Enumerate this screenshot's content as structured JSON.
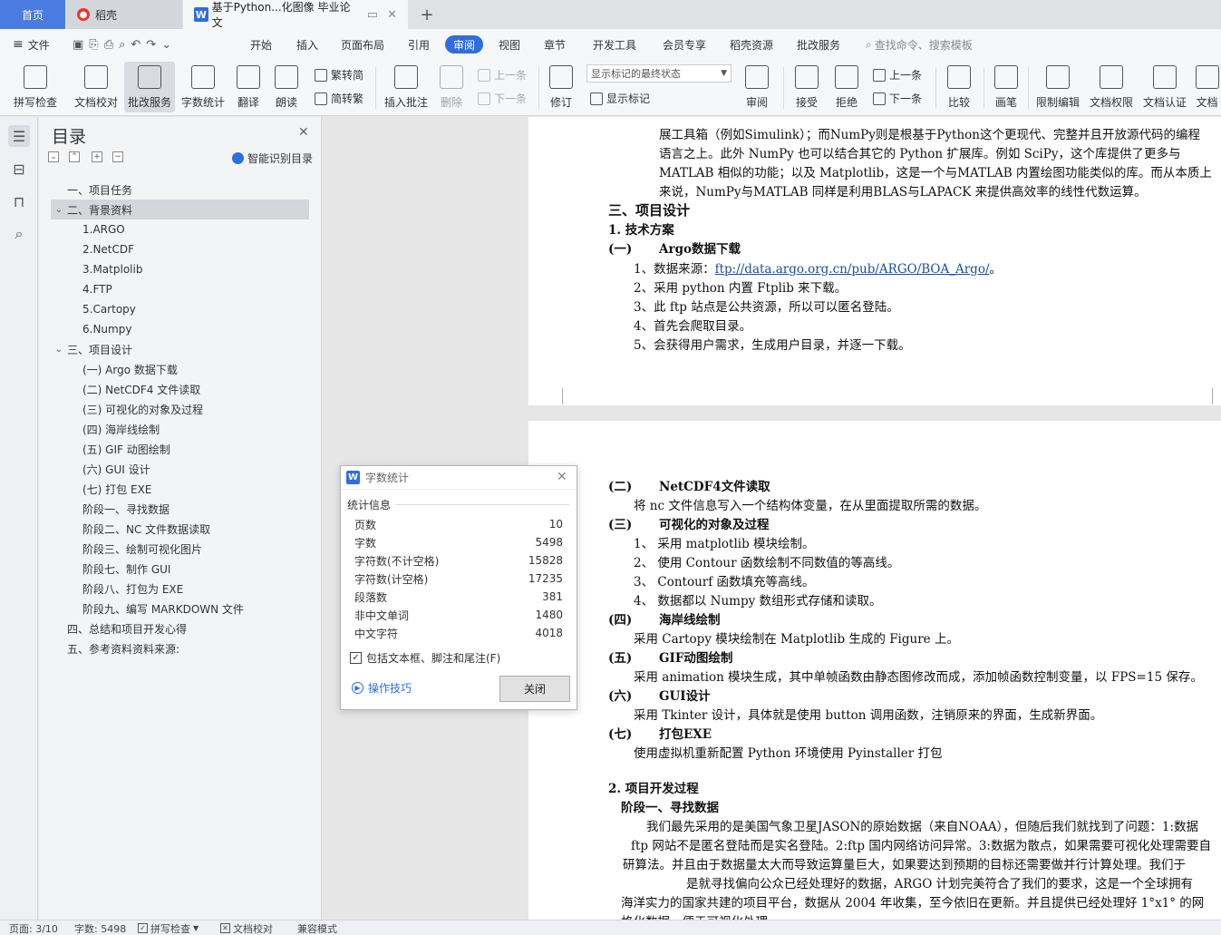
{
  "tabs": {
    "home": "首页",
    "docer": "稻壳",
    "doc_title": "基于Python...化图像 毕业论文"
  },
  "menu": [
    "文件",
    "开始",
    "插入",
    "页面布局",
    "引用",
    "审阅",
    "视图",
    "章节",
    "开发工具",
    "会员专享",
    "稻壳资源",
    "批改服务"
  ],
  "search_hint": "查找命令、搜索模板",
  "ribbon": {
    "spell_check": "拼写检查",
    "doc_proof": "文档校对",
    "correct_service": "批改服务",
    "word_count": "字数统计",
    "translate": "翻译",
    "read_aloud": "朗读",
    "trad_simp": "繁转简",
    "simp_trad": "简转繁",
    "insert_comment": "插入批注",
    "delete": "删除",
    "prev": "上一条",
    "next": "下一条",
    "revise": "修订",
    "markup_option": "显示标记的最终状态",
    "show_markup": "显示标记",
    "review": "审阅",
    "accept": "接受",
    "reject": "拒绝",
    "prev2": "上一条",
    "next2": "下一条",
    "compare": "比较",
    "pen": "画笔",
    "restrict_edit": "限制编辑",
    "doc_rights": "文档权限",
    "doc_cert": "文档认证",
    "doc_more": "文档"
  },
  "toc": {
    "title": "目录",
    "smart": "智能识别目录",
    "items": [
      {
        "label": "一、项目任务",
        "level": 1
      },
      {
        "label": "二、背景资料",
        "level": 1,
        "expanded": true,
        "selected": true
      },
      {
        "label": "1.ARGO",
        "level": 2
      },
      {
        "label": "2.NetCDF",
        "level": 2
      },
      {
        "label": "3.Matplolib",
        "level": 2
      },
      {
        "label": "4.FTP",
        "level": 2
      },
      {
        "label": "5.Cartopy",
        "level": 2
      },
      {
        "label": "6.Numpy",
        "level": 2
      },
      {
        "label": "三、项目设计",
        "level": 1,
        "expanded": true
      },
      {
        "label": "(一) Argo 数据下载",
        "level": 2
      },
      {
        "label": "(二) NetCDF4 文件读取",
        "level": 2
      },
      {
        "label": "(三) 可视化的对象及过程",
        "level": 2
      },
      {
        "label": "(四) 海岸线绘制",
        "level": 2
      },
      {
        "label": "(五) GIF 动图绘制",
        "level": 2
      },
      {
        "label": "(六) GUI 设计",
        "level": 2
      },
      {
        "label": "(七) 打包 EXE",
        "level": 2
      },
      {
        "label": "阶段一、寻找数据",
        "level": 2
      },
      {
        "label": "阶段二、NC 文件数据读取",
        "level": 2
      },
      {
        "label": "阶段三、绘制可视化图片",
        "level": 2
      },
      {
        "label": "阶段七、制作 GUI",
        "level": 2
      },
      {
        "label": "阶段八、打包为 EXE",
        "level": 2
      },
      {
        "label": "阶段九、编写 MARKDOWN 文件",
        "level": 2
      },
      {
        "label": "四、总结和项目开发心得",
        "level": 1
      },
      {
        "label": "五、参考资料资料来源:",
        "level": 1
      }
    ]
  },
  "page1": {
    "p1": "展工具箱（例如Simulink）；而NumPy则是根基于Python这个更现代、完整并且开放源代码的编程",
    "p2": "语言之上。此外 NumPy 也可以结合其它的 Python 扩展库。例如 SciPy，这个库提供了更多与",
    "p3": "MATLAB 相似的功能；以及 Matplotlib，这是一个与MATLAB 内置绘图功能类似的库。而从本质上",
    "p4": "来说，NumPy与MATLAB 同样是利用BLAS与LAPACK 来提供高效率的线性代数运算。",
    "h_design": "三、项目设计",
    "h_tech": "1. 技术方案",
    "sec1_num": "(一)",
    "sec1_title": "Argo数据下载",
    "l1_pre": "1、数据来源：",
    "l1_link": "ftp://data.argo.org.cn/pub/ARGO/BOA_Argo/",
    "l1_post": "。",
    "l2": "2、采用 python 内置 Ftplib 来下载。",
    "l3": "3、此 ftp 站点是公共资源，所以可以匿名登陆。",
    "l4": "4、首先会爬取目录。",
    "l5": "5、会获得用户需求，生成用户目录，并逐一下载。"
  },
  "page2": {
    "s2_num": "(二)",
    "s2_title": "NetCDF4文件读取",
    "s2_text": "将 nc 文件信息写入一个结构体变量，在从里面提取所需的数据。",
    "s3_num": "(三)",
    "s3_title": "可视化的对象及过程",
    "s3_l1": "1、 采用 matplotlib 模块绘制。",
    "s3_l2": "2、 使用 Contour 函数绘制不同数值的等高线。",
    "s3_l3": "3、 Contourf 函数填充等高线。",
    "s3_l4": "4、 数据都以 Numpy 数组形式存储和读取。",
    "s4_num": "(四)",
    "s4_title": "海岸线绘制",
    "s4_text": "采用 Cartopy 模块绘制在 Matplotlib 生成的 Figure 上。",
    "s5_num": "(五)",
    "s5_title": "GIF动图绘制",
    "s5_text": "采用 animation 模块生成，其中单帧函数由静态图修改而成，添加帧函数控制变量，以 FPS=15 保存。",
    "s6_num": "(六)",
    "s6_title": "GUI设计",
    "s6_text": "采用 Tkinter 设计，具体就是使用 button 调用函数，注销原来的界面，生成新界面。",
    "s7_num": "(七)",
    "s7_title": "打包EXE",
    "s7_text": "使用虚拟机重新配置 Python 环境使用 Pyinstaller 打包",
    "h_dev": "2. 项目开发过程",
    "h_stage1": "阶段一、寻找数据",
    "d1": "我们最先采用的是美国气象卫星JASON的原始数据（来自NOAA），但随后我们就找到了问题：1:数据",
    "d2": "ftp 网站不是匿名登陆而是实名登陆。2:ftp 国内网络访问异常。3:数据为散点，如果需要可视化处理需要自",
    "d3": "研算法。并且由于数据量太大而导致运算量巨大，如果要达到预期的目标还需要做并行计算处理。我们于",
    "d4": "是就寻找偏向公众已经处理好的数据，ARGO 计划完美符合了我们的要求，这是一个全球拥有",
    "d5": "海洋实力的国家共建的项目平台，数据从 2004 年收集，至今依旧在更新。并且提供已经处理好 1°x1° 的网",
    "d6": "格化数据，便于可视化处理。"
  },
  "dialog": {
    "title": "字数统计",
    "group": "统计信息",
    "rows": [
      {
        "label": "页数",
        "value": "10"
      },
      {
        "label": "字数",
        "value": "5498"
      },
      {
        "label": "字符数(不计空格)",
        "value": "15828"
      },
      {
        "label": "字符数(计空格)",
        "value": "17235"
      },
      {
        "label": "段落数",
        "value": "381"
      },
      {
        "label": "非中文单词",
        "value": "1480"
      },
      {
        "label": "中文字符",
        "value": "4018"
      }
    ],
    "include_label": "包括文本框、脚注和尾注(F)",
    "include_checked": true,
    "tips": "操作技巧",
    "close": "关闭"
  },
  "status": {
    "page": "页面: 3/10",
    "words": "字数: 5498",
    "spell": "拼写检查",
    "proof": "文档校对",
    "compat": "兼容模式"
  }
}
